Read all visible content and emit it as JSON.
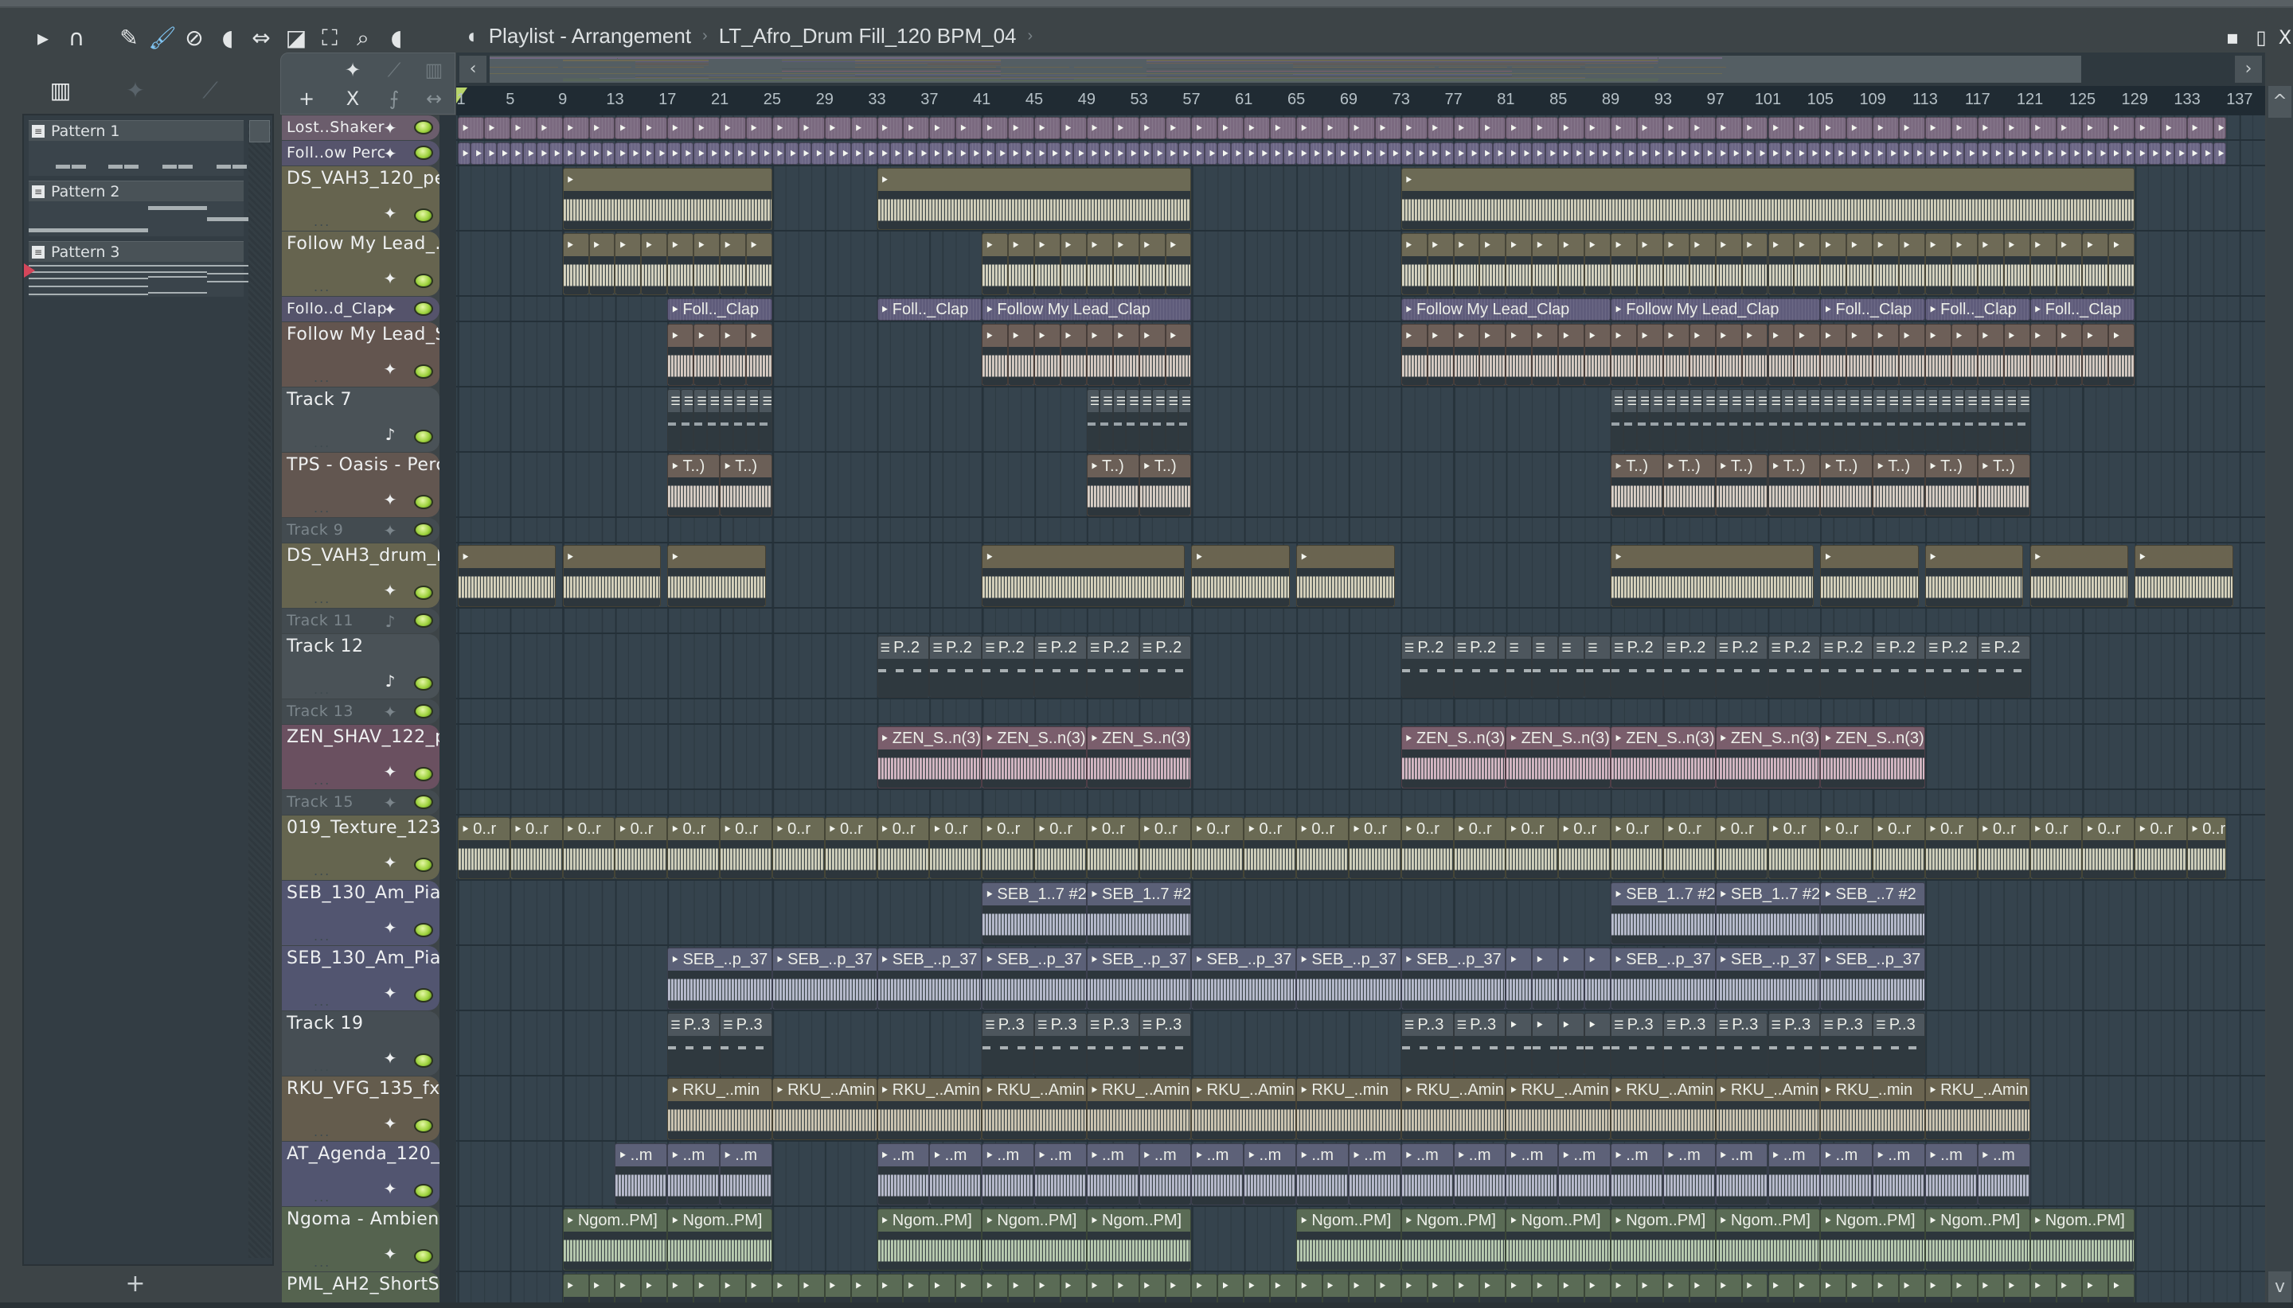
{
  "window": {
    "title": "Playlist - Arrangement",
    "breadcrumb_separator": "›",
    "current_item": "LT_Afro_Drum Fill_120 BPM_04",
    "toolbar_icons": [
      "play-arrow-icon",
      "magnet-snap-icon",
      "pencil-icon",
      "paint-brush-icon",
      "delete-icon",
      "mute-icon",
      "slip-icon",
      "slice-icon",
      "select-icon",
      "zoom-icon",
      "playback-icon",
      "speaker-icon"
    ],
    "controls": {
      "minimize": "▪",
      "maximize": "▯",
      "close": "X"
    }
  },
  "picker": {
    "tools": [
      "piano-roll-icon",
      "audio-wave-icon",
      "automation-icon"
    ],
    "patterns": [
      {
        "name": "Pattern 1"
      },
      {
        "name": "Pattern 2"
      },
      {
        "name": "Pattern 3",
        "playing": true
      }
    ],
    "add_label": "+"
  },
  "tool_tab": {
    "add_label": "+",
    "close_label": "X"
  },
  "ruler": {
    "labels": [
      1,
      5,
      9,
      13,
      17,
      21,
      25,
      29,
      33,
      37,
      41,
      45,
      49,
      53,
      57,
      61,
      65,
      69,
      73,
      77,
      81,
      85,
      89,
      93,
      97,
      101,
      105,
      109,
      113,
      117,
      121,
      125,
      129,
      133,
      137
    ]
  },
  "tracks": [
    {
      "name": "Lost..Shaker",
      "size": "small",
      "type": "audio",
      "header": "#6b5d6c",
      "clip": "#7b6a80",
      "wave": "#c9b8cc",
      "clips": [
        {
          "start": 1,
          "end": 136,
          "step": 2,
          "label": ""
        }
      ]
    },
    {
      "name": "Foll..ow Perc",
      "size": "small",
      "type": "audio",
      "header": "#56546c",
      "clip": "#6c6786",
      "wave": "#bdb8d0",
      "clips": [
        {
          "start": 1,
          "end": 136,
          "step": 1,
          "label": ""
        }
      ]
    },
    {
      "name": "DS_VAH3_120_pe..",
      "size": "tall",
      "type": "audio",
      "header": "#66644f",
      "clip": "#6c6a55",
      "wave": "#d2d0bc",
      "clips": [
        {
          "start": 9,
          "end": 25,
          "label": ""
        },
        {
          "start": 33,
          "end": 57,
          "label": ""
        },
        {
          "start": 73,
          "end": 129,
          "label": ""
        }
      ]
    },
    {
      "name": "Follow My Lead_..",
      "size": "tall",
      "type": "audio",
      "header": "#66644f",
      "clip": "#6e6a56",
      "wave": "#d6d4c2",
      "clips": [
        {
          "start": 9,
          "end": 25,
          "step": 2,
          "label": ""
        },
        {
          "start": 41,
          "end": 57,
          "step": 2,
          "label": ""
        },
        {
          "start": 73,
          "end": 129,
          "step": 2,
          "label": ""
        }
      ]
    },
    {
      "name": "Follo..d_Clap",
      "size": "small",
      "type": "audio",
      "header": "#55536b",
      "clip": "#5f5c7b",
      "wave": "#bbb8d0",
      "clips": [
        {
          "start": 17,
          "end": 25,
          "label": "Foll.._Clap"
        },
        {
          "start": 33,
          "end": 41,
          "label": "Foll.._Clap"
        },
        {
          "start": 41,
          "end": 57,
          "label": "Follow My Lead_Clap"
        },
        {
          "start": 73,
          "end": 89,
          "label": "Follow My Lead_Clap"
        },
        {
          "start": 89,
          "end": 105,
          "label": "Follow My Lead_Clap"
        },
        {
          "start": 105,
          "end": 113,
          "label": "Foll.._Clap"
        },
        {
          "start": 113,
          "end": 121,
          "label": "Foll.._Clap"
        },
        {
          "start": 121,
          "end": 129,
          "label": "Foll.._Clap"
        }
      ]
    },
    {
      "name": "Follow My Lead_S..",
      "size": "tall",
      "type": "audio",
      "header": "#63554f",
      "clip": "#6d5f58",
      "wave": "#d6ccc4",
      "clips": [
        {
          "start": 17,
          "end": 25,
          "step": 2,
          "label": ""
        },
        {
          "start": 41,
          "end": 57,
          "step": 2,
          "label": ""
        },
        {
          "start": 73,
          "end": 129,
          "step": 2,
          "label": ""
        }
      ]
    },
    {
      "name": "Track 7",
      "size": "tall",
      "type": "pattern",
      "header": "#4a5257",
      "clip": "#4c565d",
      "wave": "#9aa3a8",
      "clips": [
        {
          "start": 17,
          "end": 25,
          "step": 1,
          "label": ""
        },
        {
          "start": 49,
          "end": 57,
          "step": 1,
          "label": ""
        },
        {
          "start": 89,
          "end": 121,
          "step": 1,
          "label": ""
        }
      ]
    },
    {
      "name": "TPS - Oasis - Perc..",
      "size": "tall",
      "type": "audio",
      "header": "#625650",
      "clip": "#6b5f57",
      "wave": "#d8cfc6",
      "clips": [
        {
          "start": 17,
          "end": 25,
          "step": 4,
          "label": "T..)"
        },
        {
          "start": 49,
          "end": 57,
          "step": 4,
          "label": "T..)"
        },
        {
          "start": 89,
          "end": 121,
          "step": 4,
          "label": "T..)"
        }
      ]
    },
    {
      "name": "Track 9",
      "size": "small",
      "type": "audio",
      "dim": true,
      "header": "#434b50",
      "clips": []
    },
    {
      "name": "DS_VAH3_drum_k..",
      "size": "tall",
      "type": "audio",
      "header": "#66644f",
      "clip": "#6a6450",
      "wave": "#d6d2bd",
      "clips": [
        {
          "start": 1,
          "end": 8.5,
          "label": ""
        },
        {
          "start": 9,
          "end": 16.5,
          "label": ""
        },
        {
          "start": 17,
          "end": 24.5,
          "label": ""
        },
        {
          "start": 41,
          "end": 56.5,
          "label": ""
        },
        {
          "start": 57,
          "end": 64.5,
          "label": ""
        },
        {
          "start": 65,
          "end": 72.5,
          "label": ""
        },
        {
          "start": 89,
          "end": 104.5,
          "label": ""
        },
        {
          "start": 105,
          "end": 112.5,
          "label": ""
        },
        {
          "start": 113,
          "end": 120.5,
          "label": ""
        },
        {
          "start": 121,
          "end": 128.5,
          "label": ""
        },
        {
          "start": 129,
          "end": 136.5,
          "label": ""
        }
      ]
    },
    {
      "name": "Track 11",
      "size": "small",
      "type": "pattern",
      "dim": true,
      "header": "#434b50",
      "clips": []
    },
    {
      "name": "Track 12",
      "size": "tall",
      "type": "pattern",
      "header": "#4a5257",
      "clip": "#4d565d",
      "wave": "#a9b0b3",
      "clips": [
        {
          "start": 33,
          "end": 57,
          "step": 4,
          "label": "P..2"
        },
        {
          "start": 73,
          "end": 81,
          "step": 4,
          "label": "P..2"
        },
        {
          "start": 81,
          "end": 89,
          "step": 2,
          "label": ""
        },
        {
          "start": 89,
          "end": 121,
          "step": 4,
          "label": "P..2"
        }
      ]
    },
    {
      "name": "Track 13",
      "size": "small",
      "type": "audio",
      "dim": true,
      "header": "#434b50",
      "clips": []
    },
    {
      "name": "ZEN_SHAV_122_pl..",
      "size": "tall",
      "type": "audio",
      "header": "#6a5060",
      "clip": "#7a5e6c",
      "wave": "#d4b8c4",
      "clips": [
        {
          "start": 33,
          "end": 57,
          "step": 8,
          "label": "ZEN_S..n(3)"
        },
        {
          "start": 73,
          "end": 113,
          "step": 8,
          "label": "ZEN_S..n(3)"
        }
      ]
    },
    {
      "name": "Track 15",
      "size": "small",
      "type": "audio",
      "dim": true,
      "header": "#434b50",
      "clips": []
    },
    {
      "name": "019_Texture_123..",
      "size": "tall",
      "type": "audio",
      "header": "#65654f",
      "clip": "#6a6a54",
      "wave": "#d0d0bd",
      "clips": [
        {
          "start": 1,
          "end": 136,
          "step": 4,
          "label": "0..r"
        }
      ]
    },
    {
      "name": "SEB_130_Am_Pia..",
      "size": "tall",
      "type": "audio",
      "header": "#525570",
      "clip": "#5b6077",
      "wave": "#b8bccd",
      "clips": [
        {
          "start": 41,
          "end": 57,
          "step": 8,
          "label": "SEB_1..7 #2"
        },
        {
          "start": 89,
          "end": 105,
          "step": 8,
          "label": "SEB_1..7 #2"
        },
        {
          "start": 105,
          "end": 113,
          "label": "SEB_..7 #2"
        }
      ]
    },
    {
      "name": "SEB_130_Am_Pia..",
      "size": "tall",
      "type": "audio",
      "header": "#525570",
      "clip": "#5b6077",
      "wave": "#b8bccd",
      "clips": [
        {
          "start": 17,
          "end": 81,
          "step": 8,
          "label": "SEB_..p_37"
        },
        {
          "start": 81,
          "end": 89,
          "step": 2,
          "label": ""
        },
        {
          "start": 89,
          "end": 113,
          "step": 8,
          "label": "SEB_..p_37"
        }
      ]
    },
    {
      "name": "Track 19",
      "size": "tall",
      "type": "audio",
      "header": "#464e54",
      "clip": "#4d565d",
      "wave": "#a9b0b3",
      "clips": [
        {
          "start": 17,
          "end": 25,
          "step": 4,
          "label": "P..3"
        },
        {
          "start": 41,
          "end": 57,
          "step": 4,
          "label": "P..3"
        },
        {
          "start": 73,
          "end": 81,
          "step": 4,
          "label": "P..3"
        },
        {
          "start": 81,
          "end": 89,
          "step": 2,
          "label": ""
        },
        {
          "start": 89,
          "end": 113,
          "step": 4,
          "label": "P..3"
        }
      ]
    },
    {
      "name": "RKU_VFG_135_fx..",
      "size": "tall",
      "type": "audio",
      "header": "#645c4d",
      "clip": "#6a6450",
      "wave": "#cdc6b3",
      "clips": [
        {
          "start": 17,
          "end": 121,
          "step": 8,
          "labels": [
            "RKU_..min",
            "RKU_..Amin",
            "RKU_..Amin",
            "RKU_..Amin",
            "RKU_..Amin",
            "RKU_..Amin",
            "RKU_..min",
            "RKU_..Amin",
            "RKU_..Amin",
            "RKU_..Amin",
            "RKU_..Amin",
            "RKU_..min",
            "RKU_..Amin"
          ]
        }
      ]
    },
    {
      "name": "AT_Agenda_120_..",
      "size": "tall",
      "type": "audio",
      "header": "#525570",
      "clip": "#5d6178",
      "wave": "#b9bccd",
      "clips": [
        {
          "start": 13,
          "end": 25,
          "step": 4,
          "label": "..m"
        },
        {
          "start": 33,
          "end": 121,
          "step": 4,
          "label": "..m"
        }
      ]
    },
    {
      "name": "Ngoma - Ambien..",
      "size": "tall",
      "type": "audio",
      "header": "#55634f",
      "clip": "#5a6b55",
      "wave": "#b9cbb1",
      "clips": [
        {
          "start": 9,
          "end": 25,
          "step": 8,
          "label": "Ngom..PM]"
        },
        {
          "start": 33,
          "end": 57,
          "step": 8,
          "label": "Ngom..PM]"
        },
        {
          "start": 65,
          "end": 129,
          "step": 8,
          "label": "Ngom..PM]"
        }
      ]
    },
    {
      "name": "PML_AH2_ShortSy..",
      "size": "tall",
      "type": "audio",
      "header": "#55634f",
      "clip": "#5a6b55",
      "wave": "#b9cbb1",
      "clips": [
        {
          "start": 9,
          "end": 129,
          "step": 2,
          "label": ""
        }
      ]
    }
  ]
}
